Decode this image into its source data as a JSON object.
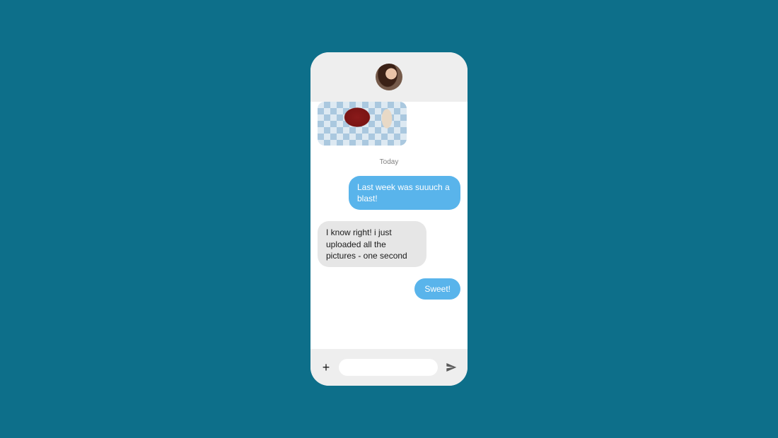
{
  "header": {
    "avatar_name": "contact-avatar"
  },
  "thread": {
    "attachment_name": "image-attachment",
    "date_separator": "Today",
    "messages": [
      {
        "side": "sent",
        "text": "Last week was suuuch a blast!"
      },
      {
        "side": "received",
        "text": "I know right! i just uploaded all the pictures - one second"
      },
      {
        "side": "sent",
        "text": "Sweet!"
      }
    ]
  },
  "composer": {
    "add_label": "+",
    "input_placeholder": "",
    "send_label": "Send"
  }
}
